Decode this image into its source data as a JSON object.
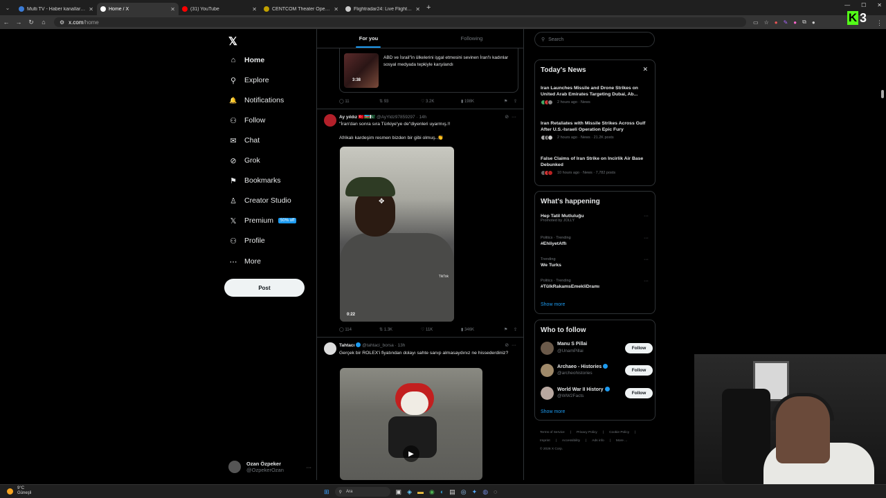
{
  "browser": {
    "tabs": [
      {
        "title": "Multi TV - Haber kanallarını ay",
        "color": "#3a7bd5",
        "active": false
      },
      {
        "title": "Home / X",
        "color": "#ffffff",
        "active": true
      },
      {
        "title": "(31) YouTube",
        "color": "#ff0000",
        "active": false
      },
      {
        "title": "CENTCOM Theater Operations",
        "color": "#c0a000",
        "active": false
      },
      {
        "title": "Flightradar24: Live Flight Track",
        "color": "#cccccc",
        "active": false
      }
    ],
    "url_host": "x.com",
    "url_path": "/home",
    "tab_close": "✕",
    "new_tab": "+"
  },
  "kick_badge": {
    "letter": "K",
    "number": "3"
  },
  "sidebar": {
    "logo": "𝕏",
    "items": [
      {
        "label": "Home",
        "icon": "⌂"
      },
      {
        "label": "Explore",
        "icon": "⚲"
      },
      {
        "label": "Notifications",
        "icon": "🔔"
      },
      {
        "label": "Follow",
        "icon": "⚇"
      },
      {
        "label": "Chat",
        "icon": "✉"
      },
      {
        "label": "Grok",
        "icon": "⊘"
      },
      {
        "label": "Bookmarks",
        "icon": "⚑"
      },
      {
        "label": "Creator Studio",
        "icon": "♙"
      },
      {
        "label": "Premium",
        "icon": "𝕏"
      },
      {
        "label": "Profile",
        "icon": "⚇"
      },
      {
        "label": "More",
        "icon": "⋯"
      }
    ],
    "premium_badge": "50% off",
    "post_button": "Post",
    "user": {
      "name": "Ozan Özpeker",
      "handle": "@OzpekerOzan"
    }
  },
  "feed": {
    "tabs": [
      "For you",
      "Following"
    ],
    "quoted_card": {
      "text": "ABD ve İsrail\"in ülkelerini işgal etmesini sevinen İran'lı kadınlar sosyal medyada tepkiyle karşılandı",
      "video_time": "3:38"
    },
    "quoted_actions": {
      "replies": "11",
      "reposts": "93",
      "likes": "3.2K",
      "views": "198K"
    },
    "tweet1": {
      "name": "Ay yıldız 🇹🇷🇦🇿🇵🇰",
      "handle": "@AyYldz97859297 · 14h",
      "text1": "\"İran'dan sonra sıra Türkiye'ye de\"diyenleri uyarmış.!!",
      "text2": "Afrikalı kardeşim resmen bizden bir gibi olmuş..👏",
      "video_time": "0:22",
      "watermark": "TikTok",
      "actions": {
        "replies": "114",
        "reposts": "1.3K",
        "likes": "11K",
        "views": "346K"
      }
    },
    "tweet2": {
      "name": "Tahtacı",
      "handle": "@tahtaci_borsa · 13h",
      "text": "Gerçek bir ROLEX'i fiyatından dolayı sahte sanıp almasaydınız ne hissederdiniz?"
    }
  },
  "right": {
    "search_placeholder": "Search",
    "todays_news": {
      "title": "Today's News",
      "items": [
        {
          "headline": "Iran Launches Missile and Drone Strikes on United Arab Emirates Targeting Dubai, Ab...",
          "meta": "2 hours ago · News"
        },
        {
          "headline": "Iran Retaliates with Missile Strikes Across Gulf After U.S.-Israeli Operation Epic Fury",
          "meta": "2 hours ago · News · 21.2K posts"
        },
        {
          "headline": "False Claims of Iran Strike on Incirlik Air Base Debunked",
          "meta": "10 hours ago · News · 7,782 posts"
        }
      ]
    },
    "whats_happening": {
      "title": "What's happening",
      "items": [
        {
          "context": "",
          "name": "Hep Tatil Mutluluğu",
          "sub": "Promoted by JOLLY"
        },
        {
          "context": "Politics · Trending",
          "name": "#EhliyetAffı",
          "sub": ""
        },
        {
          "context": "Trending",
          "name": "We Turks",
          "sub": ""
        },
        {
          "context": "Politics · Trending",
          "name": "#TülkRakamsEmekliDramı",
          "sub": ""
        }
      ],
      "show_more": "Show more"
    },
    "who_to_follow": {
      "title": "Who to follow",
      "items": [
        {
          "name": "Manu S Pillai",
          "handle": "@UnamPillai",
          "verified": false,
          "color": "#6b5a4a"
        },
        {
          "name": "Archaeo - Histories",
          "handle": "@archeohistories",
          "verified": true,
          "color": "#a08a6a"
        },
        {
          "name": "World War II History",
          "handle": "@WW2Facts",
          "verified": true,
          "color": "#b8a8a0"
        }
      ],
      "follow_label": "Follow",
      "show_more": "Show more"
    },
    "footer": {
      "links": [
        "Terms of Service",
        "|",
        "Privacy Policy",
        "|",
        "Cookie Policy",
        "|",
        "Imprint",
        "|",
        "Accessibility",
        "|",
        "Ads info",
        "|",
        "More ...",
        "© 2026 X Corp."
      ]
    }
  },
  "taskbar": {
    "weather_temp": "9°C",
    "weather_text": "Güneşli",
    "search_label": "Ara"
  }
}
